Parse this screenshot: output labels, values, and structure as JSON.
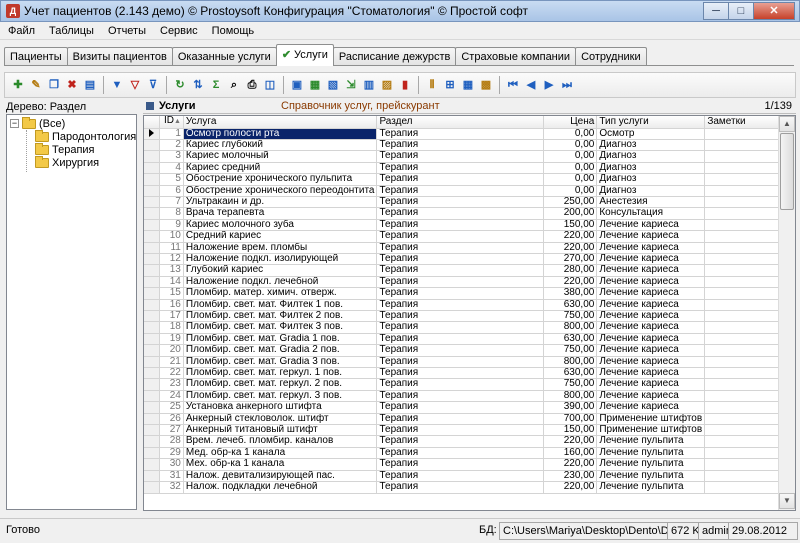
{
  "window": {
    "title": "Учет пациентов (2.143 демо) © Prostoysoft  Конфигурация \"Стоматология\" © Простой софт",
    "minimize": "─",
    "maximize": "□",
    "close": "✕"
  },
  "menu": [
    "Файл",
    "Таблицы",
    "Отчеты",
    "Сервис",
    "Помощь"
  ],
  "tabs": [
    "Пациенты",
    "Визиты пациентов",
    "Оказанные услуги",
    "Услуги",
    "Расписание дежурств",
    "Страховые компании",
    "Сотрудники"
  ],
  "active_tab": "Услуги",
  "tree": {
    "label": "Дерево: Раздел",
    "root": "(Все)",
    "expander": "−",
    "children": [
      "Пародонтология",
      "Терапия",
      "Хирургия"
    ]
  },
  "panel": {
    "title": "Услуги",
    "subtitle": "Справочник услуг, прейскурант",
    "count": "1/139"
  },
  "grid": {
    "columns": {
      "id": "ID",
      "sort_mark": "▲",
      "name": "Услуга",
      "section": "Раздел",
      "price": "Цена",
      "type": "Тип услуги",
      "notes": "Заметки"
    },
    "rows": [
      {
        "id": "1",
        "name": "Осмотр полости рта",
        "section": "Терапия",
        "price": "0,00",
        "type": "Осмотр"
      },
      {
        "id": "2",
        "name": "Кариес глубокий",
        "section": "Терапия",
        "price": "0,00",
        "type": "Диагноз"
      },
      {
        "id": "3",
        "name": "Кариес молочный",
        "section": "Терапия",
        "price": "0,00",
        "type": "Диагноз"
      },
      {
        "id": "4",
        "name": "Кариес средний",
        "section": "Терапия",
        "price": "0,00",
        "type": "Диагноз"
      },
      {
        "id": "5",
        "name": "Обострение хронического пульпита",
        "section": "Терапия",
        "price": "0,00",
        "type": "Диагноз"
      },
      {
        "id": "6",
        "name": "Обострение хронического переодонтита",
        "section": "Терапия",
        "price": "0,00",
        "type": "Диагноз"
      },
      {
        "id": "7",
        "name": "Ультракаин и др.",
        "section": "Терапия",
        "price": "250,00",
        "type": "Анестезия"
      },
      {
        "id": "8",
        "name": "Врача терапевта",
        "section": "Терапия",
        "price": "200,00",
        "type": "Консультация"
      },
      {
        "id": "9",
        "name": "Кариес молочного зуба",
        "section": "Терапия",
        "price": "150,00",
        "type": "Лечение кариеса"
      },
      {
        "id": "10",
        "name": "Средний кариес",
        "section": "Терапия",
        "price": "220,00",
        "type": "Лечение кариеса"
      },
      {
        "id": "11",
        "name": "Наложение врем. пломбы",
        "section": "Терапия",
        "price": "220,00",
        "type": "Лечение кариеса"
      },
      {
        "id": "12",
        "name": "Наложение подкл. изолирующей",
        "section": "Терапия",
        "price": "270,00",
        "type": "Лечение кариеса"
      },
      {
        "id": "13",
        "name": "Глубокий кариес",
        "section": "Терапия",
        "price": "280,00",
        "type": "Лечение кариеса"
      },
      {
        "id": "14",
        "name": "Наложение подкл. лечебной",
        "section": "Терапия",
        "price": "220,00",
        "type": "Лечение кариеса"
      },
      {
        "id": "15",
        "name": "Пломбир. матер. химич. отверж.",
        "section": "Терапия",
        "price": "380,00",
        "type": "Лечение кариеса"
      },
      {
        "id": "16",
        "name": "Пломбир. свет. мат. Филтек 1 пов.",
        "section": "Терапия",
        "price": "630,00",
        "type": "Лечение кариеса"
      },
      {
        "id": "17",
        "name": "Пломбир. свет. мат. Филтек 2 пов.",
        "section": "Терапия",
        "price": "750,00",
        "type": "Лечение кариеса"
      },
      {
        "id": "18",
        "name": "Пломбир. свет. мат. Филтек 3 пов.",
        "section": "Терапия",
        "price": "800,00",
        "type": "Лечение кариеса"
      },
      {
        "id": "19",
        "name": "Пломбир. свет. мат. Gradia 1 пов.",
        "section": "Терапия",
        "price": "630,00",
        "type": "Лечение кариеса"
      },
      {
        "id": "20",
        "name": "Пломбир. свет. мат. Gradia 2 пов.",
        "section": "Терапия",
        "price": "750,00",
        "type": "Лечение кариеса"
      },
      {
        "id": "21",
        "name": "Пломбир. свет. мат. Gradia 3 пов.",
        "section": "Терапия",
        "price": "800,00",
        "type": "Лечение кариеса"
      },
      {
        "id": "22",
        "name": "Пломбир. свет. мат. геркул. 1 пов.",
        "section": "Терапия",
        "price": "630,00",
        "type": "Лечение кариеса"
      },
      {
        "id": "23",
        "name": "Пломбир. свет. мат. геркул. 2 пов.",
        "section": "Терапия",
        "price": "750,00",
        "type": "Лечение кариеса"
      },
      {
        "id": "24",
        "name": "Пломбир. свет. мат. геркул. 3 пов.",
        "section": "Терапия",
        "price": "800,00",
        "type": "Лечение кариеса"
      },
      {
        "id": "25",
        "name": "Установка анкерного штифта",
        "section": "Терапия",
        "price": "390,00",
        "type": "Лечение кариеса"
      },
      {
        "id": "26",
        "name": "Анкерный стекловолок. штифт",
        "section": "Терапия",
        "price": "700,00",
        "type": "Применение штифтов"
      },
      {
        "id": "27",
        "name": "Анкерный титановый штифт",
        "section": "Терапия",
        "price": "150,00",
        "type": "Применение штифтов"
      },
      {
        "id": "28",
        "name": "Врем. лечеб. пломбир. каналов",
        "section": "Терапия",
        "price": "220,00",
        "type": "Лечение пульпита"
      },
      {
        "id": "29",
        "name": "Мед. обр-ка 1 канала",
        "section": "Терапия",
        "price": "160,00",
        "type": "Лечение пульпита"
      },
      {
        "id": "30",
        "name": "Мех. обр-ка 1 канала",
        "section": "Терапия",
        "price": "220,00",
        "type": "Лечение пульпита"
      },
      {
        "id": "31",
        "name": "Налож. девитализирующей пас.",
        "section": "Терапия",
        "price": "230,00",
        "type": "Лечение пульпита"
      },
      {
        "id": "32",
        "name": "Налож. подкладки лечебной",
        "section": "Терапия",
        "price": "220,00",
        "type": "Лечение пульпита"
      }
    ]
  },
  "status": {
    "left": "Готово",
    "db_label": "БД:",
    "db_path": "C:\\Users\\Mariya\\Desktop\\Dento\\Dento.mdb",
    "db_size": "672 Kb",
    "user": "admin",
    "date": "29.08.2012"
  },
  "toolbar_icons": [
    "add-record-icon",
    "edit-icon",
    "copy-icon",
    "delete-icon",
    "view-card-icon",
    "filter-icon",
    "filter-clear-icon",
    "filter-off-icon",
    "refresh-icon",
    "sort-icon",
    "sum-icon",
    "find-icon",
    "print-icon",
    "print-preview-icon",
    "export-icon",
    "export-excel-icon",
    "export-word-icon",
    "import-icon",
    "table-icon",
    "report-icon",
    "chart-icon",
    "column-settings-icon",
    "group-icon",
    "grid-icon",
    "layout-icon",
    "first-record-icon",
    "prev-record-icon",
    "next-record-icon",
    "last-record-icon"
  ]
}
